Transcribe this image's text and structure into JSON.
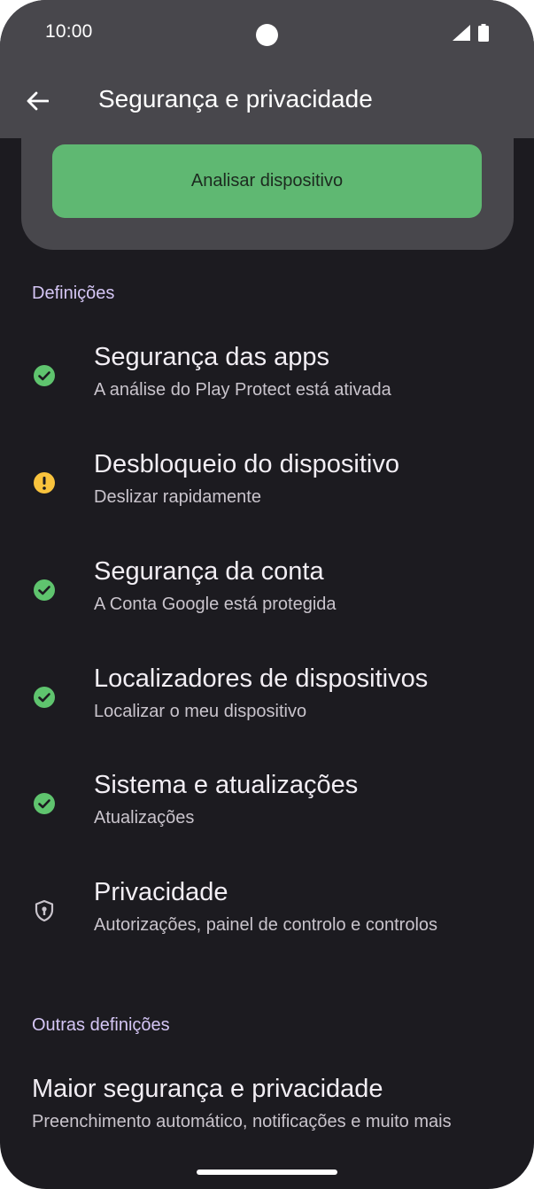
{
  "status_bar": {
    "time": "10:00",
    "icons": [
      "signal-icon",
      "battery-icon"
    ]
  },
  "header": {
    "title": "Segurança e privacidade",
    "back_icon": "arrow-back-icon"
  },
  "scan_button": {
    "label": "Analisar dispositivo"
  },
  "settings_section": {
    "heading": "Definições",
    "items": [
      {
        "title": "Segurança das apps",
        "subtitle": "A análise do Play Protect está ativada",
        "icon": "check-circle-icon",
        "status_color": "#5fc46e"
      },
      {
        "title": "Desbloqueio do dispositivo",
        "subtitle": "Deslizar rapidamente",
        "icon": "warning-circle-icon",
        "status_color": "#f9c33d"
      },
      {
        "title": "Segurança da conta",
        "subtitle": "A Conta Google está protegida",
        "icon": "check-circle-icon",
        "status_color": "#5fc46e"
      },
      {
        "title": "Localizadores de dispositivos",
        "subtitle": "Localizar o meu dispositivo",
        "icon": "check-circle-icon",
        "status_color": "#5fc46e"
      },
      {
        "title": "Sistema e atualizações",
        "subtitle": "Atualizações",
        "icon": "check-circle-icon",
        "status_color": "#5fc46e"
      },
      {
        "title": "Privacidade",
        "subtitle": "Autorizações, painel de controlo e controlos",
        "icon": "shield-lock-icon",
        "status_color": "#c9c4cc"
      }
    ]
  },
  "other_section": {
    "heading": "Outras definições",
    "items": [
      {
        "title": "Maior segurança e privacidade",
        "subtitle": "Preenchimento automático, notificações e muito mais"
      }
    ]
  },
  "colors": {
    "background": "#1c1b20",
    "app_bar": "#48474c",
    "accent_button": "#5fb872",
    "section_heading": "#d5c6f5"
  }
}
